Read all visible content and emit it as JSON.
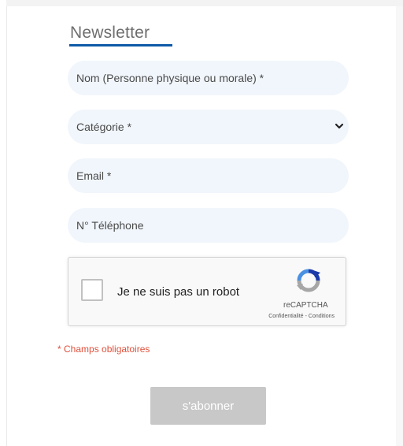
{
  "newsletter": {
    "title": "Newsletter",
    "fields": {
      "name_placeholder": "Nom (Personne physique ou morale) *",
      "category_selected": "Catégorie *",
      "email_placeholder": "Email *",
      "phone_placeholder": "N° Téléphone"
    },
    "captcha": {
      "label": "Je ne suis pas un robot",
      "brand": "reCAPTCHA",
      "privacy": "Confidentialité",
      "separator": "-",
      "terms": "Conditions",
      "icon": "recaptcha-logo"
    },
    "required_note": "* Champs obligatoires",
    "submit_label": "s'abonner",
    "colors": {
      "accent": "#0d5aa7",
      "field_bg": "#f1f6fc",
      "required": "#e0503b",
      "button_disabled": "#c8c8c8"
    }
  }
}
